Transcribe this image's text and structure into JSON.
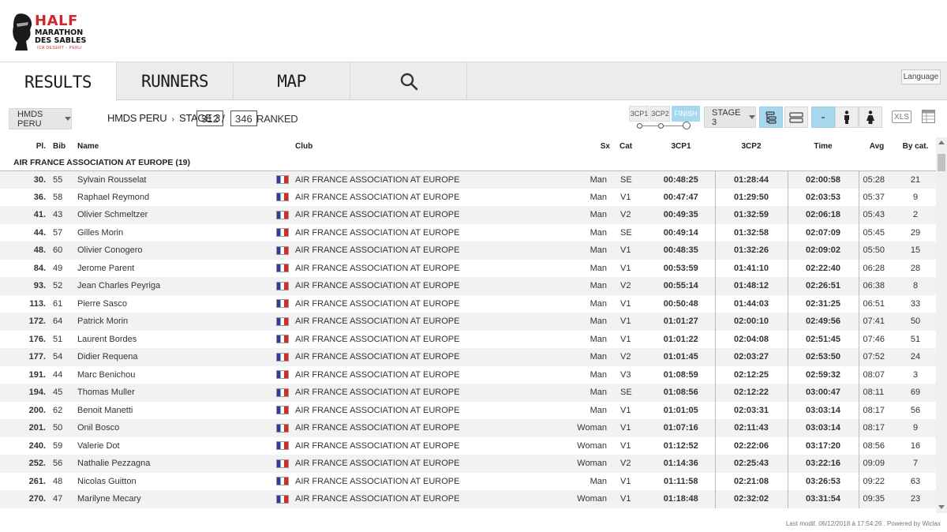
{
  "brand": {
    "line1": "HALF",
    "line2": "MARATHON",
    "line3": "DES SABLES",
    "line4": "ICA DESERT - PERU",
    "accent": "#d3252c"
  },
  "nav": {
    "tabs": [
      {
        "label": "RESULTS"
      },
      {
        "label": "RUNNERS"
      },
      {
        "label": "MAP"
      }
    ],
    "search_icon": "search-icon",
    "language": "Language"
  },
  "filter": {
    "race": "HMDS PERU",
    "breadcrumb_race": "HMDS PERU",
    "breadcrumb_sep": "›",
    "breadcrumb_stage": "STAGE 3",
    "ranked_count": "312",
    "slash": "/",
    "total_count": "346",
    "ranked_label": "RANKED",
    "checkpoints": [
      "3CP1",
      "3CP2",
      "FINISH"
    ],
    "stage": "STAGE 3",
    "xls": "XLS",
    "active_color": "#a8d8ef"
  },
  "table": {
    "headers": {
      "pl": "Pl.",
      "bib": "Bib",
      "name": "Name",
      "club": "Club",
      "sx": "Sx",
      "cat": "Cat",
      "cp1": "3CP1",
      "cp2": "3CP2",
      "time": "Time",
      "avg": "Avg",
      "bycat": "By cat."
    },
    "group": "AIR FRANCE ASSOCIATION AT EUROPE (19)",
    "rows": [
      {
        "pl": "30.",
        "bib": "55",
        "name": "Sylvain Rousselat",
        "club": "AIR FRANCE ASSOCIATION AT EUROPE",
        "sx": "Man",
        "cat": "SE",
        "cp1": "00:48:25",
        "cp2": "01:28:44",
        "time": "02:00:58",
        "avg": "05:28",
        "bycat": "21"
      },
      {
        "pl": "36.",
        "bib": "58",
        "name": "Raphael Reymond",
        "club": "AIR FRANCE ASSOCIATION AT EUROPE",
        "sx": "Man",
        "cat": "V1",
        "cp1": "00:47:47",
        "cp2": "01:29:50",
        "time": "02:03:53",
        "avg": "05:37",
        "bycat": "9"
      },
      {
        "pl": "41.",
        "bib": "43",
        "name": "Olivier Schmeltzer",
        "club": "AIR FRANCE ASSOCIATION AT EUROPE",
        "sx": "Man",
        "cat": "V2",
        "cp1": "00:49:35",
        "cp2": "01:32:59",
        "time": "02:06:18",
        "avg": "05:43",
        "bycat": "2"
      },
      {
        "pl": "44.",
        "bib": "57",
        "name": "Gilles Morin",
        "club": "AIR FRANCE ASSOCIATION AT EUROPE",
        "sx": "Man",
        "cat": "SE",
        "cp1": "00:49:14",
        "cp2": "01:32:58",
        "time": "02:07:09",
        "avg": "05:45",
        "bycat": "29"
      },
      {
        "pl": "48.",
        "bib": "60",
        "name": "Olivier Conogero",
        "club": "AIR FRANCE ASSOCIATION AT EUROPE",
        "sx": "Man",
        "cat": "V1",
        "cp1": "00:48:35",
        "cp2": "01:32:26",
        "time": "02:09:02",
        "avg": "05:50",
        "bycat": "15"
      },
      {
        "pl": "84.",
        "bib": "49",
        "name": "Jerome Parent",
        "club": "AIR FRANCE ASSOCIATION AT EUROPE",
        "sx": "Man",
        "cat": "V1",
        "cp1": "00:53:59",
        "cp2": "01:41:10",
        "time": "02:22:40",
        "avg": "06:28",
        "bycat": "28"
      },
      {
        "pl": "93.",
        "bib": "52",
        "name": "Jean Charles Peyriga",
        "club": "AIR FRANCE ASSOCIATION AT EUROPE",
        "sx": "Man",
        "cat": "V2",
        "cp1": "00:55:14",
        "cp2": "01:48:12",
        "time": "02:26:51",
        "avg": "06:38",
        "bycat": "8"
      },
      {
        "pl": "113.",
        "bib": "61",
        "name": "Pierre Sasco",
        "club": "AIR FRANCE ASSOCIATION AT EUROPE",
        "sx": "Man",
        "cat": "V1",
        "cp1": "00:50:48",
        "cp2": "01:44:03",
        "time": "02:31:25",
        "avg": "06:51",
        "bycat": "33"
      },
      {
        "pl": "172.",
        "bib": "64",
        "name": "Patrick Morin",
        "club": "AIR FRANCE ASSOCIATION AT EUROPE",
        "sx": "Man",
        "cat": "V1",
        "cp1": "01:01:27",
        "cp2": "02:00:10",
        "time": "02:49:56",
        "avg": "07:41",
        "bycat": "50"
      },
      {
        "pl": "176.",
        "bib": "51",
        "name": "Laurent Bordes",
        "club": "AIR FRANCE ASSOCIATION AT EUROPE",
        "sx": "Man",
        "cat": "V1",
        "cp1": "01:01:22",
        "cp2": "02:04:08",
        "time": "02:51:45",
        "avg": "07:46",
        "bycat": "51"
      },
      {
        "pl": "177.",
        "bib": "54",
        "name": "Didier Requena",
        "club": "AIR FRANCE ASSOCIATION AT EUROPE",
        "sx": "Man",
        "cat": "V2",
        "cp1": "01:01:45",
        "cp2": "02:03:27",
        "time": "02:53:50",
        "avg": "07:52",
        "bycat": "24"
      },
      {
        "pl": "191.",
        "bib": "44",
        "name": "Marc Benichou",
        "club": "AIR FRANCE ASSOCIATION AT EUROPE",
        "sx": "Man",
        "cat": "V3",
        "cp1": "01:08:59",
        "cp2": "02:12:25",
        "time": "02:59:32",
        "avg": "08:07",
        "bycat": "3"
      },
      {
        "pl": "194.",
        "bib": "45",
        "name": "Thomas Muller",
        "club": "AIR FRANCE ASSOCIATION AT EUROPE",
        "sx": "Man",
        "cat": "SE",
        "cp1": "01:08:56",
        "cp2": "02:12:22",
        "time": "03:00:47",
        "avg": "08:11",
        "bycat": "69"
      },
      {
        "pl": "200.",
        "bib": "62",
        "name": "Benoit Manetti",
        "club": "AIR FRANCE ASSOCIATION AT EUROPE",
        "sx": "Man",
        "cat": "V1",
        "cp1": "01:01:05",
        "cp2": "02:03:31",
        "time": "03:03:14",
        "avg": "08:17",
        "bycat": "56"
      },
      {
        "pl": "201.",
        "bib": "50",
        "name": "Onil Bosco",
        "club": "AIR FRANCE ASSOCIATION AT EUROPE",
        "sx": "Woman",
        "cat": "V1",
        "cp1": "01:07:16",
        "cp2": "02:11:43",
        "time": "03:03:14",
        "avg": "08:17",
        "bycat": "9"
      },
      {
        "pl": "240.",
        "bib": "59",
        "name": "Valerie Dot",
        "club": "AIR FRANCE ASSOCIATION AT EUROPE",
        "sx": "Woman",
        "cat": "V1",
        "cp1": "01:12:52",
        "cp2": "02:22:06",
        "time": "03:17:20",
        "avg": "08:56",
        "bycat": "16"
      },
      {
        "pl": "252.",
        "bib": "56",
        "name": "Nathalie Pezzagna",
        "club": "AIR FRANCE ASSOCIATION AT EUROPE",
        "sx": "Woman",
        "cat": "V2",
        "cp1": "01:14:36",
        "cp2": "02:25:43",
        "time": "03:22:16",
        "avg": "09:09",
        "bycat": "7"
      },
      {
        "pl": "261.",
        "bib": "48",
        "name": "Nicolas Guitton",
        "club": "AIR FRANCE ASSOCIATION AT EUROPE",
        "sx": "Man",
        "cat": "V1",
        "cp1": "01:11:58",
        "cp2": "02:21:08",
        "time": "03:26:53",
        "avg": "09:22",
        "bycat": "63"
      },
      {
        "pl": "270.",
        "bib": "47",
        "name": "Marilyne Mecary",
        "club": "AIR FRANCE ASSOCIATION AT EUROPE",
        "sx": "Woman",
        "cat": "V1",
        "cp1": "01:18:48",
        "cp2": "02:32:02",
        "time": "03:31:54",
        "avg": "09:35",
        "bycat": "23"
      }
    ]
  },
  "footer": "Last modif. 06/12/2018 à 17:54:26 . Powered by Wiclax"
}
